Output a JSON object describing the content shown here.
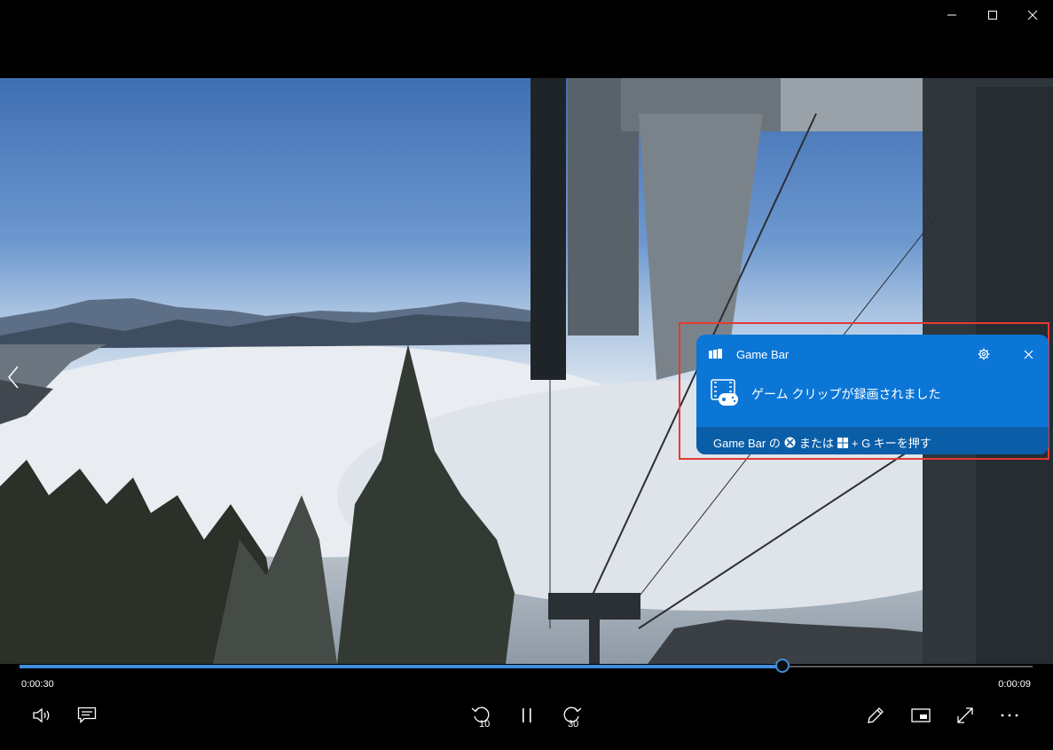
{
  "window": {
    "minimize_icon": "minimize-icon",
    "maximize_icon": "maximize-icon",
    "close_icon": "close-icon"
  },
  "player": {
    "current_time": "0:00:30",
    "remaining_time": "0:00:09",
    "progress_fraction": 0.753,
    "accent": "#3f8fdc",
    "controls": {
      "volume": "volume-icon",
      "captions": "captions-icon",
      "skip_back_label": "10",
      "play_pause": "pause-icon",
      "skip_forward_label": "30",
      "edit": "pen-icon",
      "mini_view": "mini-view-icon",
      "fullscreen": "fullscreen-icon",
      "more": "more-icon"
    }
  },
  "toast": {
    "app_name": "Game Bar",
    "message": "ゲーム クリップが録画されました",
    "footer_prefix": "Game Bar の",
    "footer_mid": "または",
    "footer_suffix": "+ G キーを押す",
    "background": "#0b76d6",
    "footer_background": "#0a5ea8",
    "highlight_color": "#e53935"
  }
}
